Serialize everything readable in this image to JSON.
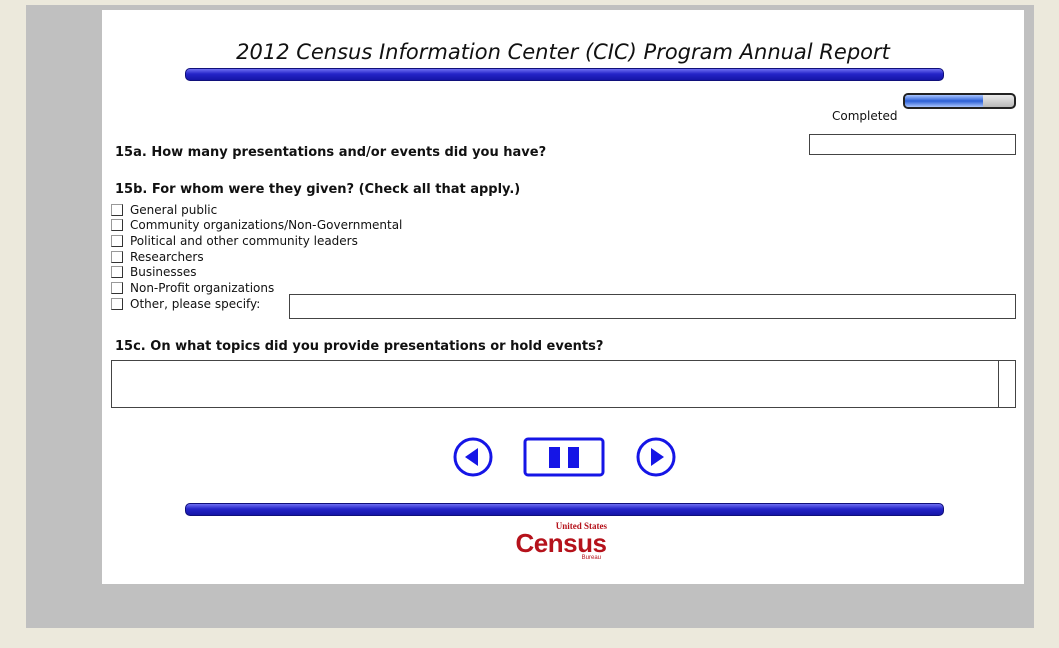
{
  "header": {
    "title": "2012 Census Information Center (CIC) Program Annual Report"
  },
  "progress": {
    "label": "Completed",
    "fraction": 0.72
  },
  "q15a": {
    "label": "15a. How many presentations and/or events did you have?",
    "value": ""
  },
  "q15b": {
    "label": "15b. For whom were they given? (Check all that apply.)",
    "options": [
      "General public",
      "Community organizations/Non-Governmental",
      "Political and other community leaders",
      "Researchers",
      "Businesses",
      "Non-Profit organizations",
      "Other, please specify:"
    ],
    "other_value": ""
  },
  "q15c": {
    "label": "15c. On what topics did you provide presentations or hold events?",
    "value": ""
  },
  "navigation": {
    "back_icon": "circle-left-arrow-icon",
    "pause_icon": "pause-icon",
    "next_icon": "circle-right-arrow-icon"
  },
  "footer": {
    "logo_top": "United States",
    "logo_main": "Census",
    "logo_bottom": "Bureau"
  },
  "colors": {
    "accent": "#2424c8",
    "nav_blue": "#1515e6",
    "census_red": "#b5121b"
  }
}
